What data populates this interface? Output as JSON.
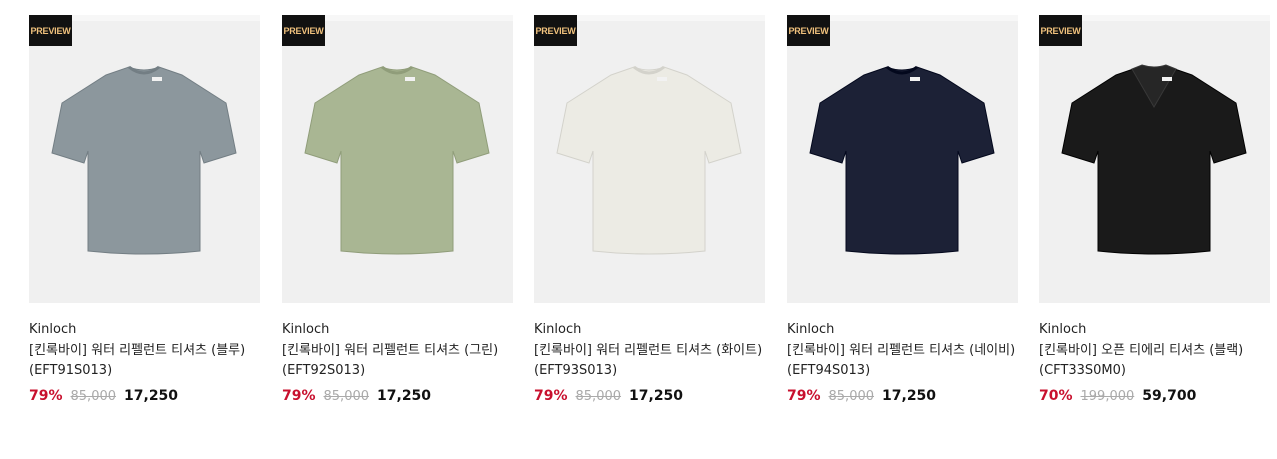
{
  "products": [
    {
      "badge": "PREVIEW",
      "brand": "Kinloch",
      "name": "[킨록바이] 워터 리펠런트 티셔츠 (블루)",
      "code": "(EFT91S013)",
      "discount": "79%",
      "original_price": "85,000",
      "sale_price": "17,250",
      "shirt_color": "#8c979d",
      "collar": "crew"
    },
    {
      "badge": "PREVIEW",
      "brand": "Kinloch",
      "name": "[킨록바이] 워터 리펠런트 티셔츠 (그린)",
      "code": "(EFT92S013)",
      "discount": "79%",
      "original_price": "85,000",
      "sale_price": "17,250",
      "shirt_color": "#a9b693",
      "collar": "crew"
    },
    {
      "badge": "PREVIEW",
      "brand": "Kinloch",
      "name": "[킨록바이] 워터 리펠런트 티셔츠 (화이트)",
      "code": "(EFT93S013)",
      "discount": "79%",
      "original_price": "85,000",
      "sale_price": "17,250",
      "shirt_color": "#ecebe4",
      "collar": "crew"
    },
    {
      "badge": "PREVIEW",
      "brand": "Kinloch",
      "name": "[킨록바이] 워터 리펠런트 티셔츠 (네이비)",
      "code": "(EFT94S013)",
      "discount": "79%",
      "original_price": "85,000",
      "sale_price": "17,250",
      "shirt_color": "#1c2136",
      "collar": "crew"
    },
    {
      "badge": "PREVIEW",
      "brand": "Kinloch",
      "name": "[킨록바이] 오픈 티에리 티셔츠 (블랙)",
      "code": "(CFT33S0M0)",
      "discount": "70%",
      "original_price": "199,000",
      "sale_price": "59,700",
      "shirt_color": "#1a1a1a",
      "collar": "open"
    }
  ]
}
